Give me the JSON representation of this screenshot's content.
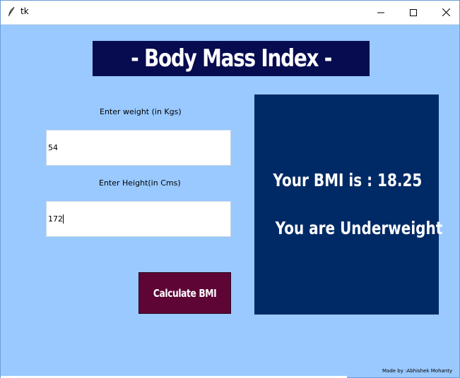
{
  "window": {
    "title": "tk",
    "background_color": "#99c9ff"
  },
  "titlebar": {
    "app_icon": "feather-icon",
    "minimize_icon": "minimize-icon",
    "maximize_icon": "maximize-icon",
    "close_icon": "close-icon"
  },
  "banner": {
    "title": "- Body Mass Index -",
    "background_color": "#070b4f"
  },
  "form": {
    "weight_label": "Enter weight (in Kgs)",
    "weight_value": "54",
    "height_label": "Enter Height(in Cms)",
    "height_value": "172",
    "calculate_label": "Calculate BMI",
    "calculate_color": "#5e0536"
  },
  "result": {
    "bmi_text": "Your BMI is : 18.25",
    "status_text": "You are Underweight",
    "panel_color": "#002a66"
  },
  "footer": {
    "credit": "Made by :Abhishek Mohanty"
  }
}
